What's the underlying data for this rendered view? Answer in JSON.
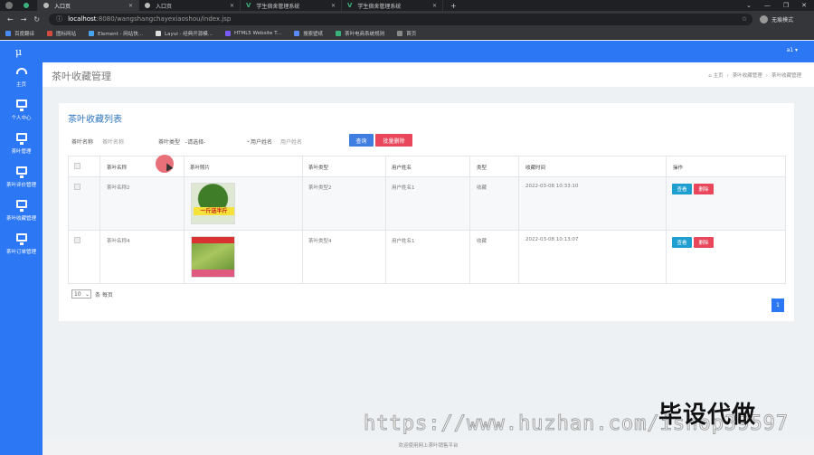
{
  "browser": {
    "tabs": [
      {
        "label": ""
      },
      {
        "label": "入口页"
      },
      {
        "label": "入口页"
      },
      {
        "label": "学生宿舍管理系统"
      },
      {
        "label": "学生宿舍管理系统"
      }
    ],
    "url_host": "localhost",
    "url_path": ":8080/wangshangchayexiaoshou/index.jsp",
    "profile": "无痕模式",
    "bookmarks": [
      "百度翻译",
      "图标网站",
      "Element - 网站快...",
      "Layui - 经典开源模...",
      "HTML5 Website T...",
      "搜索壁纸",
      "茶叶电商系统规则",
      "首页"
    ]
  },
  "app": {
    "logo": "μ",
    "user": "a1 ▾",
    "sidebar": [
      {
        "label": "主页",
        "icon": "dashboard-icon"
      },
      {
        "label": "个人中心",
        "icon": "monitor-icon"
      },
      {
        "label": "茶叶管理",
        "icon": "monitor-icon"
      },
      {
        "label": "茶叶评价管理",
        "icon": "monitor-icon"
      },
      {
        "label": "茶叶收藏管理",
        "icon": "monitor-icon"
      },
      {
        "label": "茶叶订单管理",
        "icon": "monitor-icon"
      }
    ],
    "page_title": "茶叶收藏管理",
    "breadcrumb": [
      "主页",
      "茶叶收藏管理",
      "茶叶收藏管理"
    ],
    "panel_title": "茶叶收藏列表",
    "filters": {
      "name_label": "茶叶名称",
      "name_placeholder": "茶叶名称",
      "type_label": "茶叶类型",
      "type_select": "-请选择-",
      "user_label": "用户姓名",
      "user_placeholder": "用户姓名",
      "query_button": "查询",
      "batch_delete_button": "批量删除"
    },
    "table": {
      "headers": [
        "茶叶名称",
        "茶叶照片",
        "茶叶类型",
        "用户姓名",
        "类型",
        "收藏时间",
        "操作"
      ],
      "rows": [
        {
          "name": "茶叶名称2",
          "photo_text": "一斤送半斤",
          "type": "茶叶类型2",
          "user": "用户姓名1",
          "kind": "收藏",
          "time": "2022-03-08 10:33:10"
        },
        {
          "name": "茶叶名称4",
          "photo_text": "",
          "type": "茶叶类型4",
          "user": "用户姓名1",
          "kind": "收藏",
          "time": "2022-03-08 10:13:07"
        }
      ],
      "view_label": "查看",
      "delete_label": "删除"
    },
    "pager": {
      "page_size": "10",
      "suffix": "条 每页",
      "current_page": "1"
    },
    "footer": "欢迎使用网上茶叶销售平台"
  },
  "watermark": {
    "url": "https://www.huzhan.com/ishop39597",
    "brand": "毕设代做"
  },
  "colors": {
    "primary": "#2b77f4",
    "danger": "#e9465b",
    "info": "#1f9fd0",
    "title": "#2f76c1"
  }
}
